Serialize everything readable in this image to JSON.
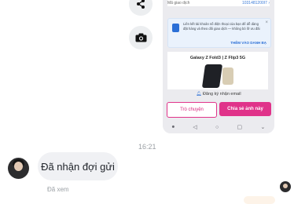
{
  "shared_screenshot": {
    "order_label": "Mã giao dịch",
    "order_id": "1031481200I7 ›",
    "notice_text": "Liên kết tài khoản số điện thoại của bạn để dễ dàng đặt hàng và theo dõi giao dịch — không bỏ lỡ ưu đãi",
    "notice_link": "THÊM VÀO DANH BẠ",
    "ad_title": "Galaxy Z Fold3 | Z Flip3 5G",
    "email_text": "Đăng ký nhận email",
    "chat_button": "Trò chuyện",
    "share_button": "Chia sẻ ảnh này",
    "nav_icons": [
      "⦁",
      "◁",
      "○",
      "▢",
      "⌄"
    ]
  },
  "conversation": {
    "timestamp": "16:21",
    "message": "Đã nhận đợi gửi",
    "status": "Đã xem"
  },
  "icons": {
    "share": "share-icon",
    "camera": "camera-icon",
    "bell": "bell-icon"
  },
  "colors": {
    "accent": "#e0338a",
    "link": "#2b6fd6",
    "bubble": "#f0f1f4"
  }
}
